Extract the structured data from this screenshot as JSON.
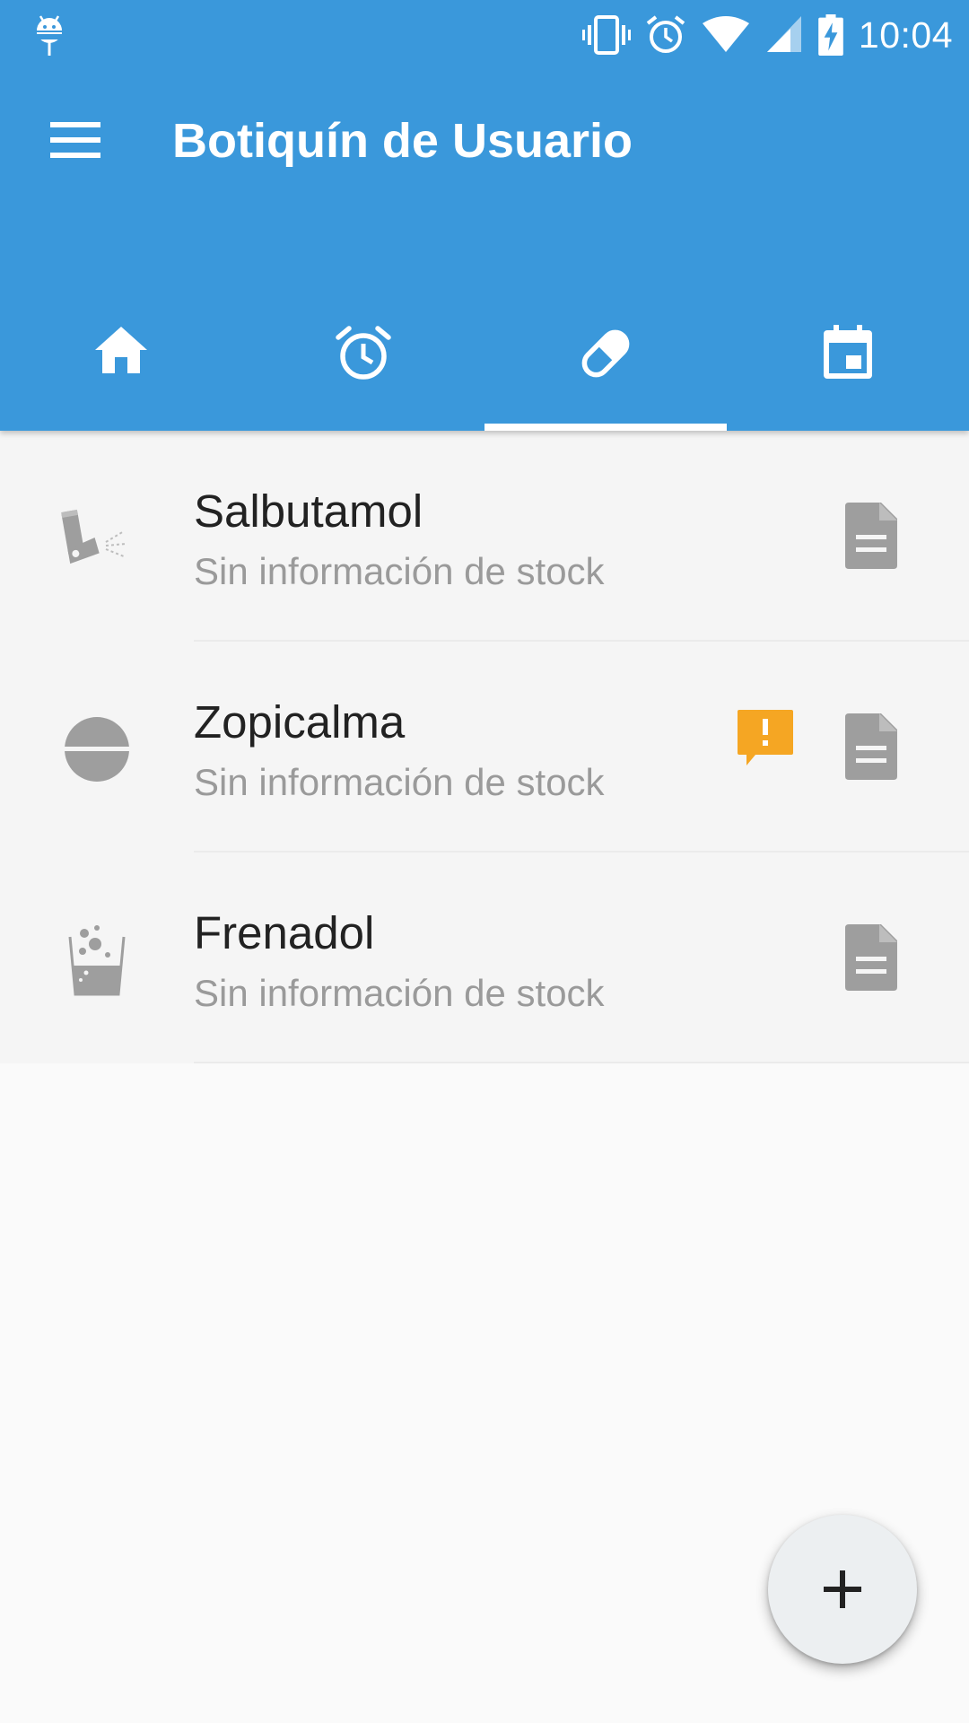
{
  "status_bar": {
    "time": "10:04",
    "icons": [
      "android-debug-icon",
      "vibrate-icon",
      "alarm-icon",
      "wifi-icon",
      "signal-icon",
      "battery-charging-icon"
    ]
  },
  "toolbar": {
    "title": "Botiquín de Usuario",
    "menu_icon": "menu-icon"
  },
  "tabs": [
    {
      "icon": "home-icon",
      "selected": false
    },
    {
      "icon": "alarm-clock-icon",
      "selected": false
    },
    {
      "icon": "pill-icon",
      "selected": true
    },
    {
      "icon": "calendar-icon",
      "selected": false
    }
  ],
  "medicines": [
    {
      "name": "Salbutamol",
      "stock": "Sin información de stock",
      "icon": "inhaler-icon",
      "warning": false
    },
    {
      "name": "Zopicalma",
      "stock": "Sin información de stock",
      "icon": "tablet-icon",
      "warning": true
    },
    {
      "name": "Frenadol",
      "stock": "Sin información de stock",
      "icon": "effervescent-glass-icon",
      "warning": false
    }
  ],
  "fab": {
    "icon": "plus-icon"
  },
  "colors": {
    "primary": "#3a98db",
    "warning": "#f5a623",
    "icon_gray": "#9e9e9e"
  }
}
